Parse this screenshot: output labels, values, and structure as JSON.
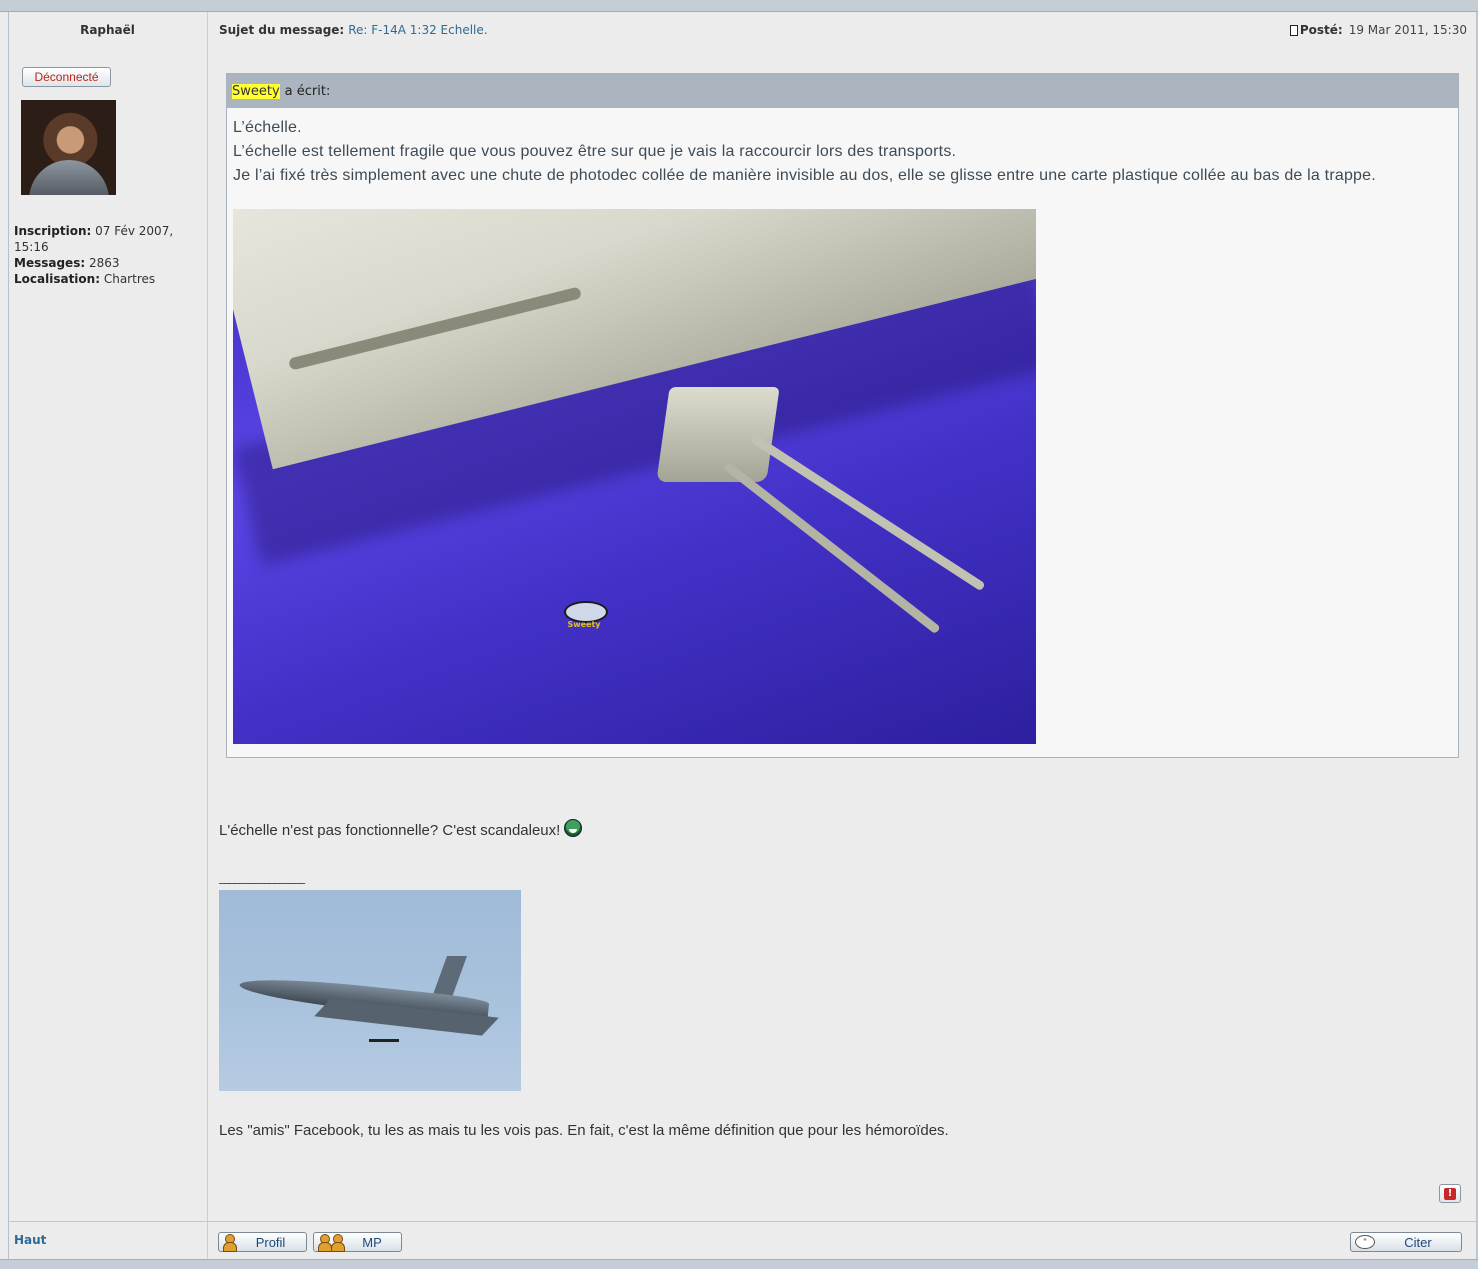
{
  "author": {
    "name": "Raphaël",
    "status": "Déconnecté",
    "meta": {
      "registered_label": "Inscription:",
      "registered_value": "07 Fév 2007, 15:16",
      "messages_label": "Messages:",
      "messages_value": "2863",
      "location_label": "Localisation:",
      "location_value": "Chartres"
    }
  },
  "post": {
    "subject_label": "Sujet du message:",
    "subject_value": "Re: F-14A 1:32 Echelle.",
    "posted_label": "Posté:",
    "posted_value": "19 Mar 2011, 15:30",
    "quote": {
      "user": "Sweety",
      "wrote": "a écrit:",
      "lines": [
        "L’échelle.",
        "L’échelle est tellement fragile que vous pouvez être sur que je vais la raccourcir lors des transports.",
        "Je l’ai fixé très simplement avec une chute de photodec collée de manière invisible au dos, elle se glisse entre une carte plastique collée au bas de la trappe."
      ],
      "image_watermark": "Sweety"
    },
    "reply": "L'échelle n'est pas fonctionnelle? C'est scandaleux!",
    "smiley_icon": "grin-smiley-icon",
    "signature_rule": "_________________",
    "signature_quote": "Les \"amis\" Facebook, tu les as mais tu les vois pas. En fait, c'est la même définition que pour les hémoroïdes."
  },
  "actions": {
    "back_to_top": "Haut",
    "profile": "Profil",
    "pm": "MP",
    "quote": "Citer",
    "report_icon": "report-icon",
    "report_glyph": "!"
  },
  "colors": {
    "accent_link": "#2c6b96",
    "quote_header": "#aab5bf",
    "highlight": "#ffff33",
    "background": "#ececec"
  }
}
